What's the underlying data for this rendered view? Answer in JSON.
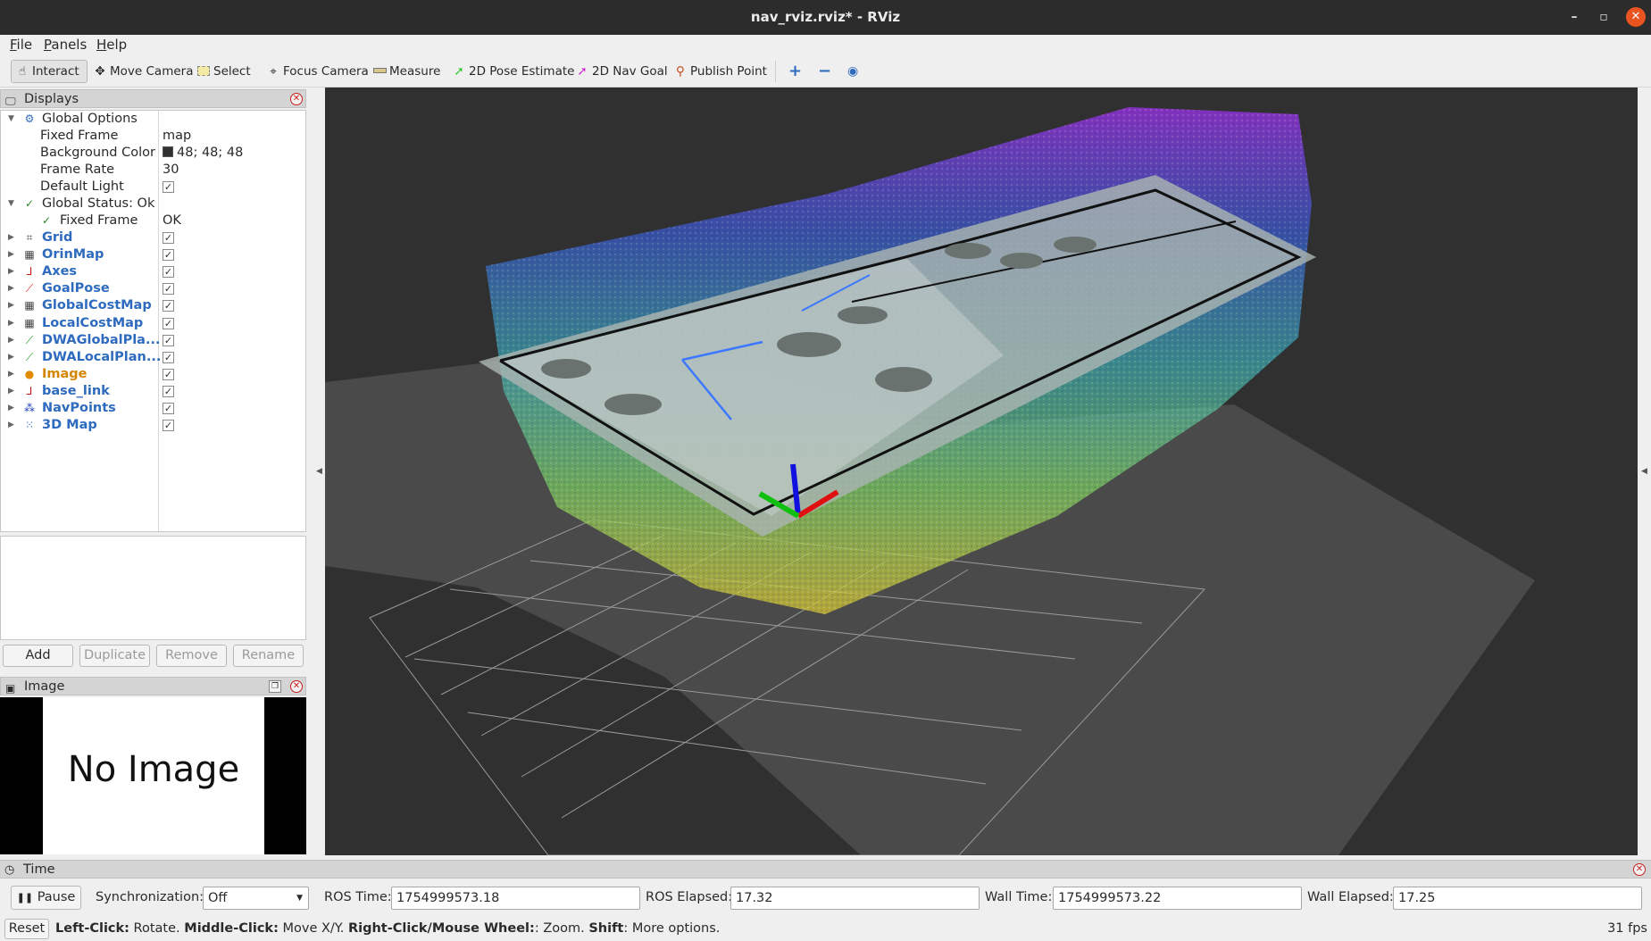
{
  "window": {
    "title": "nav_rviz.rviz* - RViz"
  },
  "menu": [
    {
      "underline": "F",
      "rest": "ile"
    },
    {
      "underline": "P",
      "rest": "anels"
    },
    {
      "underline": "H",
      "rest": "elp"
    }
  ],
  "toolbar": {
    "interact": "Interact",
    "move_camera": "Move Camera",
    "select": "Select",
    "focus_camera": "Focus Camera",
    "measure": "Measure",
    "pose_estimate": "2D Pose Estimate",
    "nav_goal": "2D Nav Goal",
    "publish_point": "Publish Point"
  },
  "displays": {
    "title": "Displays",
    "global_options": "Global Options",
    "fixed_frame_label": "Fixed Frame",
    "fixed_frame_value": "map",
    "background_color_label": "Background Color",
    "background_color_value": "48; 48; 48",
    "background_color_hex": "#303030",
    "frame_rate_label": "Frame Rate",
    "frame_rate_value": "30",
    "default_light_label": "Default Light",
    "global_status": "Global Status: Ok",
    "fixed_frame_status_label": "Fixed Frame",
    "fixed_frame_status_value": "OK",
    "items": [
      {
        "name": "Grid",
        "icon": "grid-icon",
        "enabled": true,
        "warn": false
      },
      {
        "name": "OrinMap",
        "icon": "map-icon",
        "enabled": true,
        "warn": false
      },
      {
        "name": "Axes",
        "icon": "axes-icon",
        "enabled": true,
        "warn": false
      },
      {
        "name": "GoalPose",
        "icon": "pose-icon",
        "enabled": true,
        "warn": false
      },
      {
        "name": "GlobalCostMap",
        "icon": "map-icon",
        "enabled": true,
        "warn": false
      },
      {
        "name": "LocalCostMap",
        "icon": "map-icon",
        "enabled": true,
        "warn": false
      },
      {
        "name": "DWAGlobalPla...",
        "icon": "path-icon",
        "enabled": true,
        "warn": false
      },
      {
        "name": "DWALocalPlan...",
        "icon": "path-icon",
        "enabled": true,
        "warn": false
      },
      {
        "name": "Image",
        "icon": "warning-icon",
        "enabled": true,
        "warn": true
      },
      {
        "name": "base_link",
        "icon": "axes-icon",
        "enabled": true,
        "warn": false
      },
      {
        "name": "NavPoints",
        "icon": "markers-icon",
        "enabled": true,
        "warn": false
      },
      {
        "name": "3D Map",
        "icon": "pointcloud-icon",
        "enabled": true,
        "warn": false
      }
    ],
    "buttons": {
      "add": "Add",
      "duplicate": "Duplicate",
      "remove": "Remove",
      "rename": "Rename"
    }
  },
  "image_panel": {
    "title": "Image",
    "placeholder": "No Image"
  },
  "time": {
    "title": "Time",
    "pause": "Pause",
    "sync_label": "Synchronization:",
    "sync_value": "Off",
    "ros_time_label": "ROS Time:",
    "ros_time": "1754999573.18",
    "ros_elapsed_label": "ROS Elapsed:",
    "ros_elapsed": "17.32",
    "wall_time_label": "Wall Time:",
    "wall_time": "1754999573.22",
    "wall_elapsed_label": "Wall Elapsed:",
    "wall_elapsed": "17.25"
  },
  "status": {
    "reset": "Reset",
    "hint_parts": [
      {
        "bold": "Left-Click:",
        "text": " Rotate. "
      },
      {
        "bold": "Middle-Click:",
        "text": " Move X/Y. "
      },
      {
        "bold": "Right-Click/Mouse Wheel:",
        "text": ": Zoom. "
      },
      {
        "bold": "Shift",
        "text": ": More options."
      }
    ],
    "fps": "31 fps"
  }
}
